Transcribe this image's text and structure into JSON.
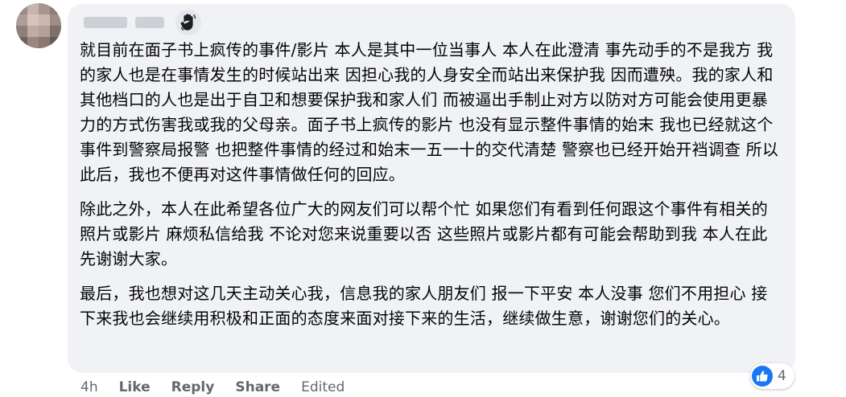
{
  "comment": {
    "paragraphs": [
      "就目前在面子书上疯传的事件/影片 本人是其中一位当事人 本人在此澄清 事先动手的不是我方 我的家人也是在事情发生的时候站出来 因担心我的人身安全而站出来保护我 因而遭殃。我的家人和其他档口的人也是出于自卫和想要保护我和家人们 而被逼出手制止对方以防对方可能会使用更暴力的方式伤害我或我的父母亲。面子书上疯传的影片 也没有显示整件事情的始末 我也已经就这个事件到警察局报警 也把整件事情的经过和始末一五一十的交代清楚 警察也已经开始开裆调查 所以此后，我也不便再对这件事情做任何的回应。",
      "除此之外，本人在此希望各位广大的网友们可以帮个忙 如果您们有看到任何跟这个事件有相关的照片或影片 麻烦私信给我 不论对您来说重要以否 这些照片或影片都有可能会帮助到我 本人在此先谢谢大家。",
      "最后，我也想对这几天主动关心我，信息我的家人朋友们 报一下平安 本人没事 您们不用担心 接下来我也会继续用积极和正面的态度来面对接下来的生活，继续做生意，谢谢您们的关心。"
    ],
    "badge_icon": "waving-hand-icon"
  },
  "actions": {
    "time": "4h",
    "like": "Like",
    "reply": "Reply",
    "share": "Share",
    "edited": "Edited"
  },
  "reactions": {
    "icon": "like-reaction-icon",
    "count": "4",
    "color": "#1877f2"
  },
  "colors": {
    "bubble_bg": "#f0f2f5",
    "secondary_text": "#65676b",
    "primary_text": "#050505"
  }
}
